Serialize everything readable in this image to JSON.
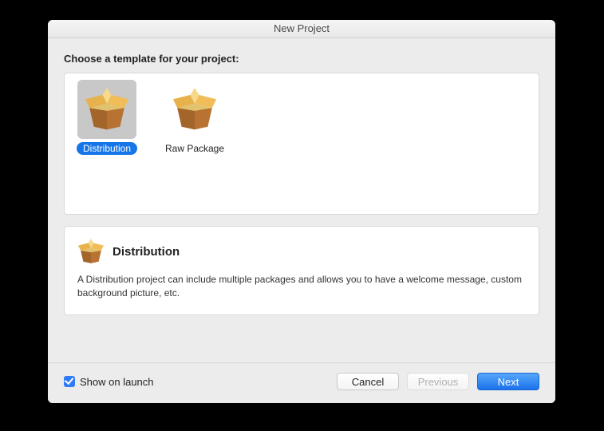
{
  "window": {
    "title": "New Project"
  },
  "heading": "Choose a template for your project:",
  "templates": [
    {
      "label": "Distribution",
      "selected": true
    },
    {
      "label": "Raw Package",
      "selected": false
    }
  ],
  "description": {
    "title": "Distribution",
    "text": "A Distribution project can include multiple packages and allows you to have a welcome message, custom background picture, etc."
  },
  "footer": {
    "checkbox_label": "Show on launch",
    "checkbox_checked": true,
    "cancel": "Cancel",
    "previous": "Previous",
    "next": "Next"
  }
}
